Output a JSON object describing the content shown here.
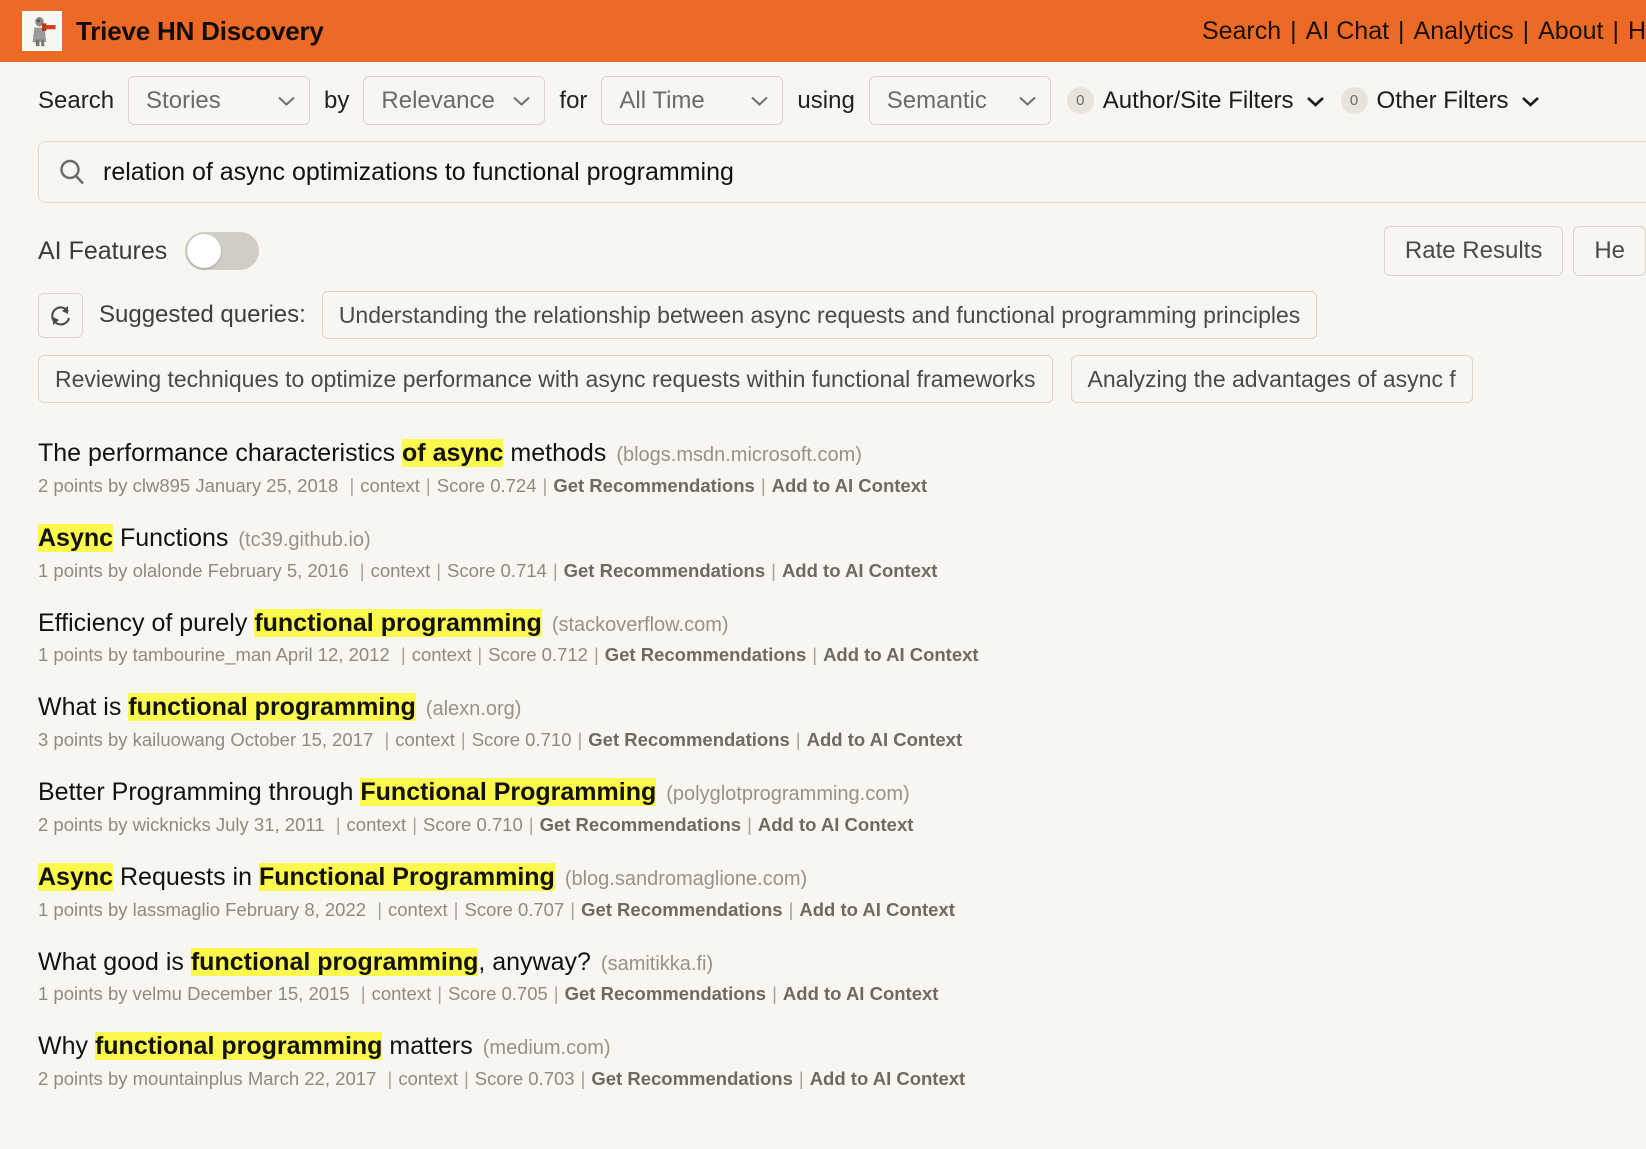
{
  "header": {
    "brand_title": "Trieve HN Discovery",
    "logo_icon": "hn-person-icon",
    "nav": [
      {
        "label": "Search"
      },
      {
        "label": "AI Chat"
      },
      {
        "label": "Analytics"
      },
      {
        "label": "About"
      },
      {
        "label": "H"
      }
    ],
    "nav_separator": "|",
    "bg_color": "#ec6a26"
  },
  "filter_bar": {
    "word_search": "Search",
    "word_by": "by",
    "word_for": "for",
    "word_using": "using",
    "content_type": {
      "value": "Stories",
      "icon": "chevron-down-icon"
    },
    "sort_by": {
      "value": "Relevance",
      "icon": "chevron-down-icon"
    },
    "time_range": {
      "value": "All Time",
      "icon": "chevron-down-icon"
    },
    "search_mode": {
      "value": "Semantic",
      "icon": "chevron-down-icon"
    },
    "author_site_filters": {
      "count": "0",
      "label": "Author/Site Filters",
      "icon": "chevron-down-icon"
    },
    "other_filters": {
      "count": "0",
      "label": "Other Filters",
      "icon": "chevron-down-icon"
    }
  },
  "search": {
    "icon": "search-icon",
    "value": "relation of async optimizations to functional programming",
    "placeholder": "Search"
  },
  "ai_features": {
    "label": "AI Features",
    "toggle_state": "off",
    "rate_results_label": "Rate Results",
    "help_label": "He"
  },
  "suggested": {
    "refresh_icon": "refresh-icon",
    "label": "Suggested queries:",
    "queries": [
      "Understanding the relationship between async requests and functional programming principles",
      "Reviewing techniques to optimize performance with async requests within functional frameworks",
      "Analyzing the advantages of async f"
    ]
  },
  "results": [
    {
      "title_parts": [
        {
          "text": "The performance characteristics ",
          "hl": false
        },
        {
          "text": "of async",
          "hl": true
        },
        {
          "text": " methods",
          "hl": false
        }
      ],
      "domain": "(blogs.msdn.microsoft.com)",
      "points": "2 points",
      "by": "by clw895",
      "date": "January 25, 2018",
      "context_label": "context",
      "score": "Score 0.724",
      "get_recommendations": "Get Recommendations",
      "add_to_ai_context": "Add to AI Context"
    },
    {
      "title_parts": [
        {
          "text": "Async",
          "hl": true
        },
        {
          "text": " Functions",
          "hl": false
        }
      ],
      "domain": "(tc39.github.io)",
      "points": "1 points",
      "by": "by olalonde",
      "date": "February 5, 2016",
      "context_label": "context",
      "score": "Score 0.714",
      "get_recommendations": "Get Recommendations",
      "add_to_ai_context": "Add to AI Context"
    },
    {
      "title_parts": [
        {
          "text": "Efficiency of purely ",
          "hl": false
        },
        {
          "text": "functional programming",
          "hl": true
        }
      ],
      "domain": "(stackoverflow.com)",
      "points": "1 points",
      "by": "by tambourine_man",
      "date": "April 12, 2012",
      "context_label": "context",
      "score": "Score 0.712",
      "get_recommendations": "Get Recommendations",
      "add_to_ai_context": "Add to AI Context"
    },
    {
      "title_parts": [
        {
          "text": "What is ",
          "hl": false
        },
        {
          "text": "functional programming",
          "hl": true
        }
      ],
      "domain": "(alexn.org)",
      "points": "3 points",
      "by": "by kailuowang",
      "date": "October 15, 2017",
      "context_label": "context",
      "score": "Score 0.710",
      "get_recommendations": "Get Recommendations",
      "add_to_ai_context": "Add to AI Context"
    },
    {
      "title_parts": [
        {
          "text": "Better Programming through ",
          "hl": false
        },
        {
          "text": "Functional Programming",
          "hl": true
        }
      ],
      "domain": "(polyglotprogramming.com)",
      "points": "2 points",
      "by": "by wicknicks",
      "date": "July 31, 2011",
      "context_label": "context",
      "score": "Score 0.710",
      "get_recommendations": "Get Recommendations",
      "add_to_ai_context": "Add to AI Context"
    },
    {
      "title_parts": [
        {
          "text": "Async",
          "hl": true
        },
        {
          "text": " Requests in ",
          "hl": false
        },
        {
          "text": "Functional Programming",
          "hl": true
        }
      ],
      "domain": "(blog.sandromaglione.com)",
      "points": "1 points",
      "by": "by lassmaglio",
      "date": "February 8, 2022",
      "context_label": "context",
      "score": "Score 0.707",
      "get_recommendations": "Get Recommendations",
      "add_to_ai_context": "Add to AI Context"
    },
    {
      "title_parts": [
        {
          "text": "What good is ",
          "hl": false
        },
        {
          "text": "functional programming",
          "hl": true
        },
        {
          "text": ", anyway?",
          "hl": false
        }
      ],
      "domain": "(samitikka.fi)",
      "points": "1 points",
      "by": "by velmu",
      "date": "December 15, 2015",
      "context_label": "context",
      "score": "Score 0.705",
      "get_recommendations": "Get Recommendations",
      "add_to_ai_context": "Add to AI Context"
    },
    {
      "title_parts": [
        {
          "text": "Why ",
          "hl": false
        },
        {
          "text": "functional programming",
          "hl": true
        },
        {
          "text": " matters",
          "hl": false
        }
      ],
      "domain": "(medium.com)",
      "points": "2 points",
      "by": "by mountainplus",
      "date": "March 22, 2017",
      "context_label": "context",
      "score": "Score 0.703",
      "get_recommendations": "Get Recommendations",
      "add_to_ai_context": "Add to AI Context"
    }
  ],
  "theme": {
    "accent": "#ec6a26",
    "page_bg": "#f7f6f1",
    "highlight": "#fbf94d",
    "muted_text": "#8e8a80"
  }
}
